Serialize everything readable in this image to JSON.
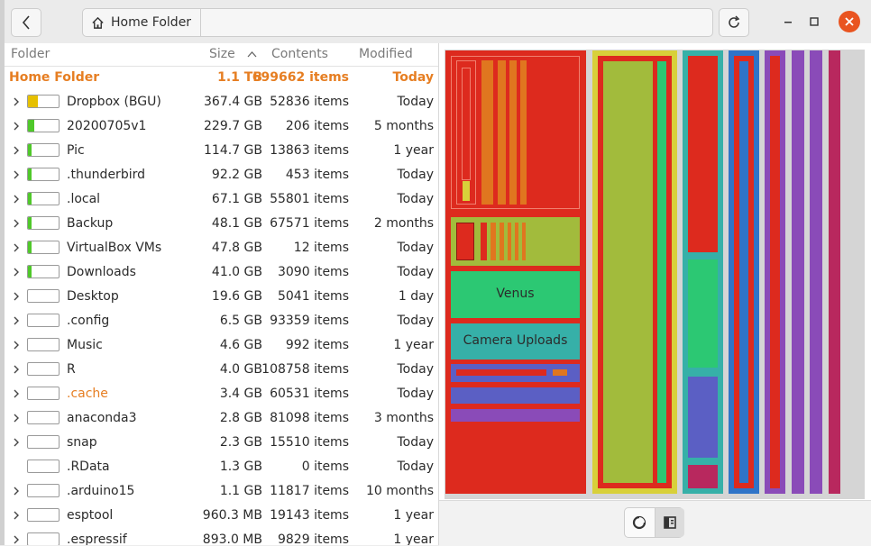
{
  "header": {
    "path_label": "Home Folder",
    "back_icon": "chevron-left-icon",
    "home_icon": "home-icon",
    "reload_icon": "reload-icon"
  },
  "columns": {
    "folder": "Folder",
    "size": "Size",
    "contents": "Contents",
    "modified": "Modified"
  },
  "root": {
    "name": "Home Folder",
    "size": "1.1 TB",
    "contents": "699662 items",
    "modified": "Today"
  },
  "rows": [
    {
      "name": "Dropbox (BGU)",
      "size": "367.4 GB",
      "contents": "52836 items",
      "modified": "Today",
      "usage": 0.33,
      "fill_color": "#e6c000",
      "expandable": true
    },
    {
      "name": "20200705v1",
      "size": "229.7 GB",
      "contents": "206 items",
      "modified": "5 months",
      "usage": 0.21,
      "fill_color": "#4fc82a",
      "expandable": true
    },
    {
      "name": "Pic",
      "size": "114.7 GB",
      "contents": "13863 items",
      "modified": "1 year",
      "usage": 0.1,
      "fill_color": "#4fc82a",
      "expandable": true
    },
    {
      "name": ".thunderbird",
      "size": "92.2 GB",
      "contents": "453 items",
      "modified": "Today",
      "usage": 0.08,
      "fill_color": "#4fc82a",
      "expandable": true
    },
    {
      "name": ".local",
      "size": "67.1 GB",
      "contents": "55801 items",
      "modified": "Today",
      "usage": 0.06,
      "fill_color": "#4fc82a",
      "expandable": true
    },
    {
      "name": "Backup",
      "size": "48.1 GB",
      "contents": "67571 items",
      "modified": "2 months",
      "usage": 0.04,
      "fill_color": "#4fc82a",
      "expandable": true
    },
    {
      "name": "VirtualBox VMs",
      "size": "47.8 GB",
      "contents": "12 items",
      "modified": "Today",
      "usage": 0.04,
      "fill_color": "#4fc82a",
      "expandable": true
    },
    {
      "name": "Downloads",
      "size": "41.0 GB",
      "contents": "3090 items",
      "modified": "Today",
      "usage": 0.04,
      "fill_color": "#4fc82a",
      "expandable": true
    },
    {
      "name": "Desktop",
      "size": "19.6 GB",
      "contents": "5041 items",
      "modified": "1 day",
      "usage": 0.0,
      "fill_color": "#4fc82a",
      "expandable": true
    },
    {
      "name": ".config",
      "size": "6.5 GB",
      "contents": "93359 items",
      "modified": "Today",
      "usage": 0.0,
      "fill_color": "#4fc82a",
      "expandable": true
    },
    {
      "name": "Music",
      "size": "4.6 GB",
      "contents": "992 items",
      "modified": "1 year",
      "usage": 0.0,
      "fill_color": "#4fc82a",
      "expandable": true
    },
    {
      "name": "R",
      "size": "4.0 GB",
      "contents": "108758 items",
      "modified": "Today",
      "usage": 0.0,
      "fill_color": "#4fc82a",
      "expandable": true
    },
    {
      "name": ".cache",
      "size": "3.4 GB",
      "contents": "60531 items",
      "modified": "Today",
      "usage": 0.0,
      "fill_color": "#4fc82a",
      "expandable": true,
      "highlight": true
    },
    {
      "name": "anaconda3",
      "size": "2.8 GB",
      "contents": "81098 items",
      "modified": "3 months",
      "usage": 0.0,
      "fill_color": "#4fc82a",
      "expandable": true
    },
    {
      "name": "snap",
      "size": "2.3 GB",
      "contents": "15510 items",
      "modified": "Today",
      "usage": 0.0,
      "fill_color": "#4fc82a",
      "expandable": true
    },
    {
      "name": ".RData",
      "size": "1.3 GB",
      "contents": "0 items",
      "modified": "Today",
      "usage": 0.0,
      "fill_color": "#4fc82a",
      "expandable": false
    },
    {
      "name": ".arduino15",
      "size": "1.1 GB",
      "contents": "11817 items",
      "modified": "10 months",
      "usage": 0.0,
      "fill_color": "#4fc82a",
      "expandable": true
    },
    {
      "name": "esptool",
      "size": "960.3 MB",
      "contents": "19143 items",
      "modified": "1 year",
      "usage": 0.0,
      "fill_color": "#4fc82a",
      "expandable": true
    },
    {
      "name": ".espressif",
      "size": "893.0 MB",
      "contents": "9829 items",
      "modified": "1 year",
      "usage": 0.0,
      "fill_color": "#4fc82a",
      "expandable": true
    }
  ],
  "treemap": {
    "labels": {
      "venus": "Venus",
      "camera_uploads": "Camera Uploads"
    },
    "colors": {
      "red": "#dd2a1e",
      "olive": "#a2bb3c",
      "yellow": "#d8d03a",
      "teal": "#36b0a8",
      "green": "#2cc873",
      "blue": "#2f74c8",
      "purple": "#8a4bb8",
      "magenta": "#b8285e",
      "orange": "#e0761f",
      "indigo": "#5b5fc4"
    }
  },
  "chart_switch": {
    "ring_icon": "ring-chart-icon",
    "treemap_icon": "treemap-chart-icon"
  }
}
